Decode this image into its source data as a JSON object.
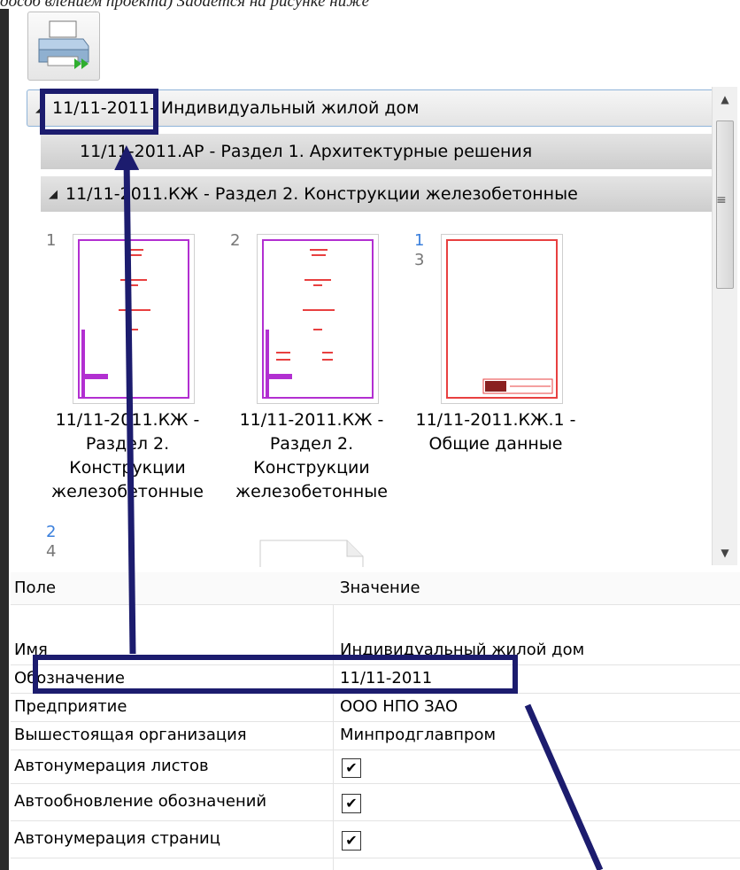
{
  "caption": "дособ влением проекта) Задается на рисунке ниже",
  "toolbar": {
    "print_icon": "printer-forward-icon"
  },
  "tree": {
    "root": {
      "code": "11/11-2011",
      "title": " - Индивидуальный жилой дом"
    },
    "sections": [
      {
        "label": "11/11-2011.АР - Раздел 1. Архитектурные решения",
        "expanded": false
      },
      {
        "label": "11/11-2011.КЖ - Раздел 2. Конструкции железобетонные",
        "expanded": true
      }
    ],
    "thumbnails": [
      {
        "num1": "1",
        "num2": "",
        "label": "11/11-2011.КЖ - Раздел 2. Конструкции железобетонные"
      },
      {
        "num1": "2",
        "num2": "",
        "label": "11/11-2011.КЖ - Раздел 2. Конструкции железобетонные"
      },
      {
        "num1": "1",
        "num2": "3",
        "label": "11/11-2011.КЖ.1 - Общие данные"
      }
    ],
    "next_item": {
      "num1": "2",
      "num2": "4"
    }
  },
  "properties": {
    "headers": {
      "field": "Поле",
      "value": "Значение"
    },
    "rows": [
      {
        "field": "Имя",
        "value": "Индивидуальный жилой дом"
      },
      {
        "field": "Обозначение",
        "value": "11/11-2011"
      },
      {
        "field": "Предприятие",
        "value": "ООО НПО ЗАО"
      },
      {
        "field": "Вышестоящая организация",
        "value": "Минпродглавпром"
      },
      {
        "field": "Автонумерация листов",
        "checked": true
      },
      {
        "field": "Автообновление обозначений",
        "checked": true
      },
      {
        "field": "Автонумерация страниц",
        "checked": true
      }
    ],
    "check_glyph": "✔"
  },
  "colors": {
    "annotation": "#1c1c6e",
    "selection": "#8fb4d9",
    "page_border": "#b22fd1"
  }
}
